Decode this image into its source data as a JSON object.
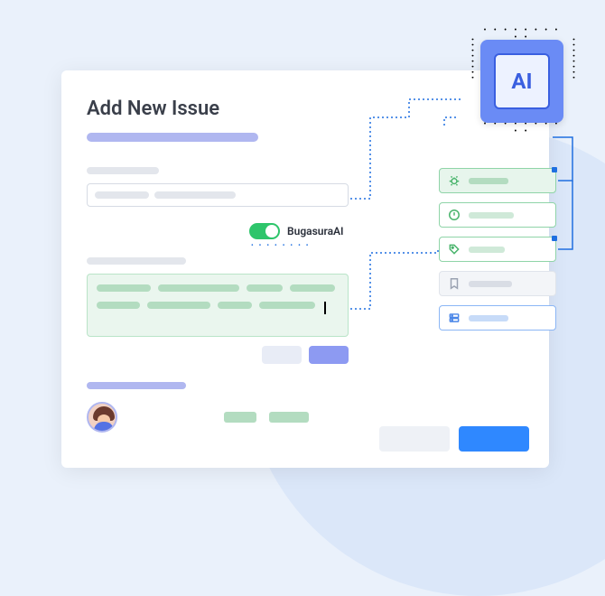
{
  "form": {
    "title": "Add New Issue",
    "ai_toggle": {
      "label": "BugasuraAI",
      "enabled": true
    }
  },
  "ai_chip": {
    "label": "AI"
  },
  "suggestions": [
    {
      "name": "bug",
      "variant": "green-fill",
      "icon": "bug-icon",
      "color": "#47b36a"
    },
    {
      "name": "priority",
      "variant": "green-outline",
      "icon": "alert-circle-icon",
      "color": "#47b36a"
    },
    {
      "name": "tag",
      "variant": "green-outline",
      "icon": "tag-icon",
      "color": "#47b36a"
    },
    {
      "name": "bookmark",
      "variant": "gray",
      "icon": "bookmark-icon",
      "color": "#9aa2b1"
    },
    {
      "name": "server",
      "variant": "blue",
      "icon": "server-icon",
      "color": "#4a86e8"
    }
  ],
  "colors": {
    "primary": "#2f88ff",
    "accent_green": "#2ec56b",
    "indigo": "#b0b7f0",
    "chip_blue": "#3a5fe0"
  }
}
